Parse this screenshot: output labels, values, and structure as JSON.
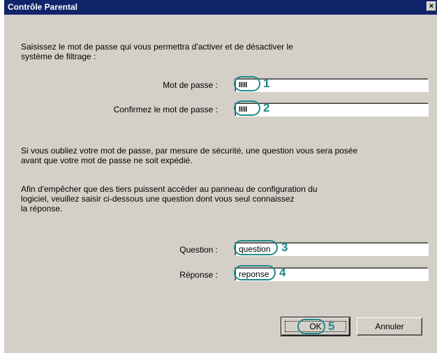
{
  "window": {
    "title": "Contrôle Parental",
    "close_label": "×"
  },
  "intro": {
    "line1": "Saisissez le mot de passe qui vous permettra d'activer et de désactiver le",
    "line2": "système de filtrage :"
  },
  "password": {
    "label": "Mot de passe :",
    "value": "IIII",
    "callout": "1"
  },
  "confirm": {
    "label": "Confirmez le mot de passe :",
    "value": "IIII",
    "callout": "2"
  },
  "security_note": {
    "line1": "Si vous oubliez votre mot de passe, par mesure de sécurité, une question vous sera posée",
    "line2": "avant que votre mot de passe ne soit expédié."
  },
  "question_note": {
    "line1": "Afin d'empêcher que des tiers puissent accéder au panneau de configuration du",
    "line2": "logiciel, veuillez saisir ci-dessous une question dont vous seul connaissez",
    "line3": "la réponse."
  },
  "question": {
    "label": "Question :",
    "value": "question",
    "callout": "3"
  },
  "answer": {
    "label": "Réponse :",
    "value": "reponse",
    "callout": "4"
  },
  "buttons": {
    "ok_label": "OK",
    "ok_callout": "5",
    "cancel_label": "Annuler"
  },
  "colors": {
    "titlebar": "#10246a",
    "callout": "#1f8a8a",
    "dialog_face": "#d4d0c8"
  }
}
